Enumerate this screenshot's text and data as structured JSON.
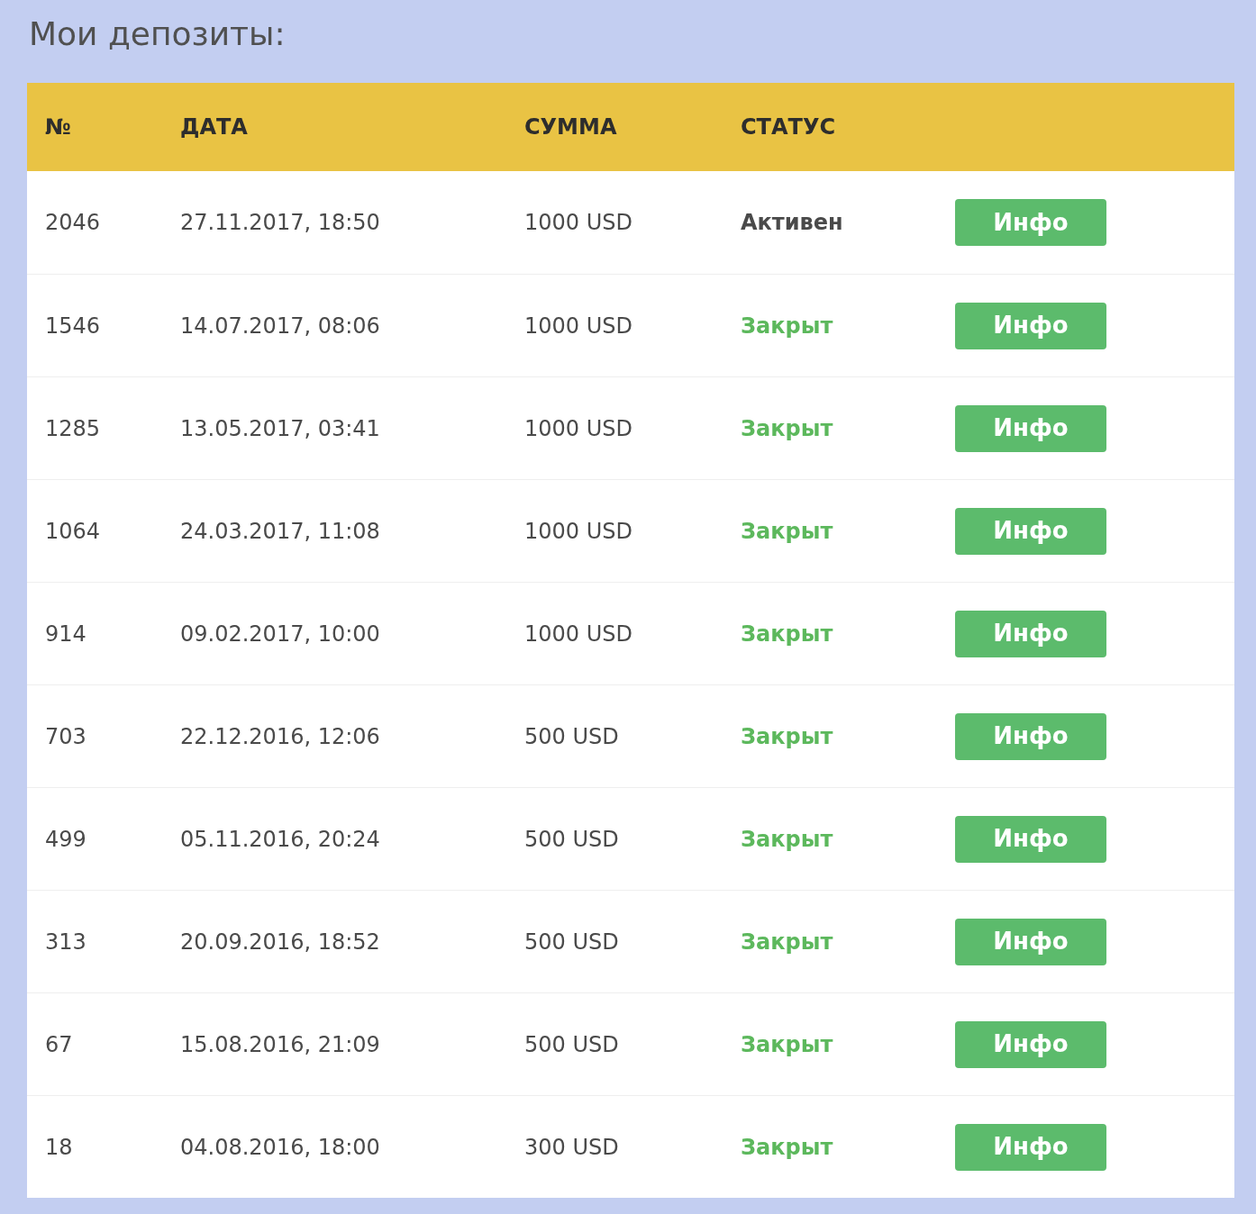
{
  "title": "Мои депозиты:",
  "table": {
    "columns": [
      "№",
      "ДАТА",
      "СУММА",
      "СТАТУС"
    ],
    "rows": [
      {
        "number": "2046",
        "date": "27.11.2017, 18:50",
        "amount": "1000 USD",
        "status": {
          "text": "Активен",
          "kind": "active"
        },
        "button": "Инфо"
      },
      {
        "number": "1546",
        "date": "14.07.2017, 08:06",
        "amount": "1000 USD",
        "status": {
          "text": "Закрыт",
          "kind": "closed"
        },
        "button": "Инфо"
      },
      {
        "number": "1285",
        "date": "13.05.2017, 03:41",
        "amount": "1000 USD",
        "status": {
          "text": "Закрыт",
          "kind": "closed"
        },
        "button": "Инфо"
      },
      {
        "number": "1064",
        "date": "24.03.2017, 11:08",
        "amount": "1000 USD",
        "status": {
          "text": "Закрыт",
          "kind": "closed"
        },
        "button": "Инфо"
      },
      {
        "number": "914",
        "date": "09.02.2017, 10:00",
        "amount": "1000 USD",
        "status": {
          "text": "Закрыт",
          "kind": "closed"
        },
        "button": "Инфо"
      },
      {
        "number": "703",
        "date": "22.12.2016, 12:06",
        "amount": "500 USD",
        "status": {
          "text": "Закрыт",
          "kind": "closed"
        },
        "button": "Инфо"
      },
      {
        "number": "499",
        "date": "05.11.2016, 20:24",
        "amount": "500 USD",
        "status": {
          "text": "Закрыт",
          "kind": "closed"
        },
        "button": "Инфо"
      },
      {
        "number": "313",
        "date": "20.09.2016, 18:52",
        "amount": "500 USD",
        "status": {
          "text": "Закрыт",
          "kind": "closed"
        },
        "button": "Инфо"
      },
      {
        "number": "67",
        "date": "15.08.2016, 21:09",
        "amount": "500 USD",
        "status": {
          "text": "Закрыт",
          "kind": "closed"
        },
        "button": "Инфо"
      },
      {
        "number": "18",
        "date": "04.08.2016, 18:00",
        "amount": "300 USD",
        "status": {
          "text": "Закрыт",
          "kind": "closed"
        },
        "button": "Инфо"
      }
    ]
  }
}
